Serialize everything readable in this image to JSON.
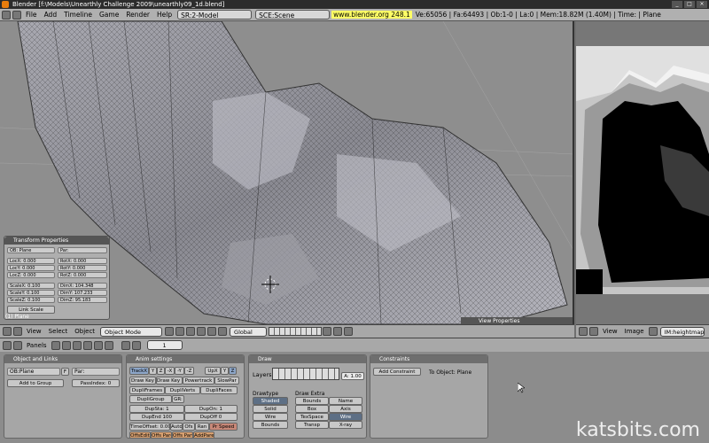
{
  "window": {
    "title": "Blender [f:\\Models\\Unearthly Challenge 2009\\unearthly09_1d.blend]"
  },
  "topbar": {
    "menus": [
      "File",
      "Add",
      "Timeline",
      "Game",
      "Render",
      "Help"
    ],
    "screen": "SR:2-Model",
    "scene": "SCE:Scene",
    "url": "www.blender.org 248.1",
    "stats": "Ve:65056 | Fa:64493 | Ob:1-0 | La:0  | Mem:18.82M (1.40M) | Time: | Plane"
  },
  "transform_panel": {
    "title": "Transform Properties",
    "ob": "OB: Plane",
    "par": "Par:",
    "loc": [
      "LocX: 0.000",
      "LocY: 0.000",
      "LocZ: 0.000"
    ],
    "rot": [
      "RotX: 0.000",
      "RotY: 0.000",
      "RotZ: 0.000"
    ],
    "scale": [
      "ScaleX: 0.100",
      "ScaleY: 0.100",
      "ScaleZ: 0.100"
    ],
    "dim": [
      "DimX: 104.348",
      "DimY: 107.233",
      "DimZ: 95.183"
    ],
    "link_scale": "Link Scale",
    "object_label": "(1) Plane"
  },
  "view_properties": "View Properties",
  "viewport_header": {
    "menus": [
      "View",
      "Select",
      "Object"
    ],
    "mode": "Object Mode",
    "orientation": "Global"
  },
  "image_header": {
    "menus": [
      "View",
      "Image"
    ],
    "image_name": "IM:heightmap"
  },
  "buttons_header": {
    "panels_label": "Panels",
    "frame": "1"
  },
  "panels": {
    "object_links": {
      "title": "Object and Links",
      "ob": "OB:Plane",
      "f": "F",
      "par": "Par:",
      "add_group": "Add to Group",
      "pass_index": "PassIndex: 0"
    },
    "anim": {
      "title": "Anim settings",
      "track": [
        "TrackX",
        "Y",
        "Z",
        "-X",
        "-Y",
        "-Z"
      ],
      "up": [
        "UpX",
        "Y",
        "Z"
      ],
      "row2": [
        "Draw Key",
        "Draw Key S",
        "Powertrack",
        "SlowPar"
      ],
      "row3": [
        "DupliFrames",
        "DupliVerts",
        "DupliFaces"
      ],
      "row4": [
        "DupliGroup",
        "GR:"
      ],
      "dupsta": "DupSta: 1",
      "dupon": "DupOn: 1",
      "dupend": "DupEnd 100",
      "dupoff": "DupOff 0",
      "row6": [
        "TimeOffset: 0.00",
        "Auto",
        "Ofs",
        "Ran",
        "Pr Speed"
      ],
      "row7": [
        "OffsEdit",
        "Offs Paren",
        "Offs Partic",
        "AddParent"
      ]
    },
    "draw": {
      "title": "Draw",
      "layers": "Layers",
      "alpha": "A: 1.00",
      "drawtype_label": "Drawtype",
      "drawtypes": [
        "Shaded",
        "Solid",
        "Wire",
        "Bounds"
      ],
      "drawextra_label": "Draw Extra",
      "extras": [
        "Bounds",
        "Box",
        "TexSpace",
        "Transp"
      ],
      "extras2": [
        "Name",
        "Axis",
        "Wire",
        "X-ray"
      ]
    },
    "constraints": {
      "title": "Constraints",
      "add": "Add Constraint",
      "to": "To Object: Plane"
    }
  },
  "watermark": "katsbits.com",
  "colors": {
    "accent": "#e87d0d",
    "panel_header": "#6e6e6e",
    "selected": "#5d6f85"
  }
}
